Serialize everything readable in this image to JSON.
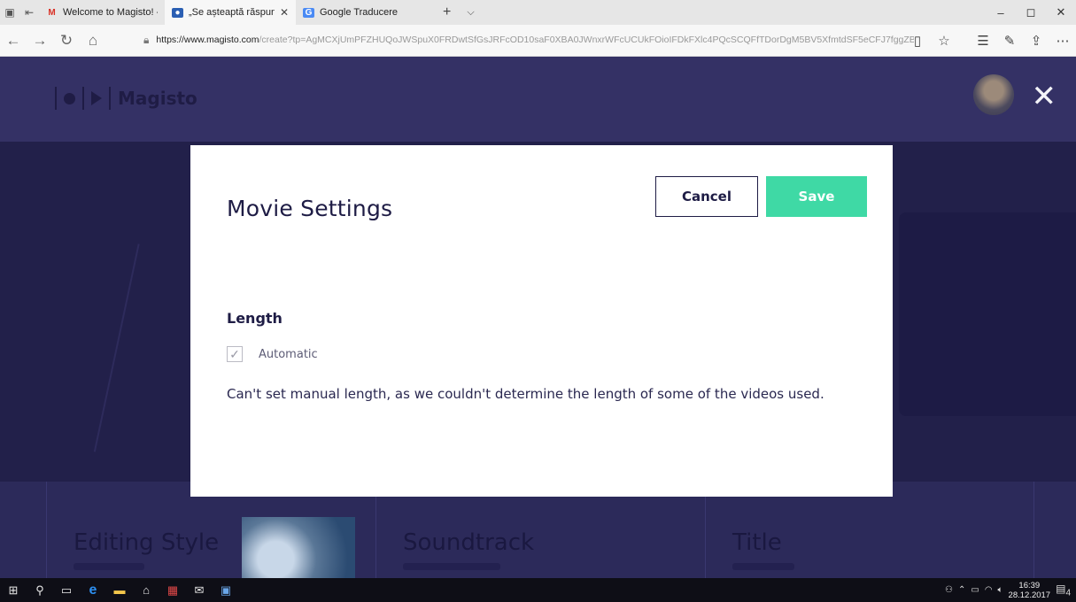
{
  "browser": {
    "tabs": [
      {
        "label": "Welcome to Magisto! - agai",
        "favicon": "gmail-icon",
        "active": false
      },
      {
        "label": "„Se așteaptă răspunsul",
        "favicon": "magisto-icon",
        "active": true
      },
      {
        "label": "Google Traducere",
        "favicon": "translate-icon",
        "active": false
      }
    ],
    "url_host": "https://www.magisto.com",
    "url_path": "/create?tp=AgMCXjUmPFZHUQoJWSpuX0FRDwtSfGsJRFcOD10saF0XBA0JWnxrWFcUCUkFOioIFDkFXlc4PQcSCQFfTDorDgM5BV5XfmtdSF5eCFJ7fggZBwJUC",
    "window_controls": [
      "–",
      "◻",
      "✕"
    ]
  },
  "page": {
    "logo_text": "Magisto",
    "cards": [
      {
        "title": "Editing Style"
      },
      {
        "title": "Soundtrack"
      },
      {
        "title": "Title"
      }
    ]
  },
  "modal": {
    "title": "Movie Settings",
    "cancel_label": "Cancel",
    "save_label": "Save",
    "section_title": "Length",
    "checkbox_label": "Automatic",
    "checkbox_checked": true,
    "note": "Can't set manual length, as we couldn't determine the length of some of the videos used."
  },
  "taskbar": {
    "time": "16:39",
    "date": "28.12.2017",
    "notifications": "4"
  },
  "colors": {
    "accent": "#3fd9a5",
    "navy": "#1e1c45",
    "page_bg": "#2a2755"
  }
}
